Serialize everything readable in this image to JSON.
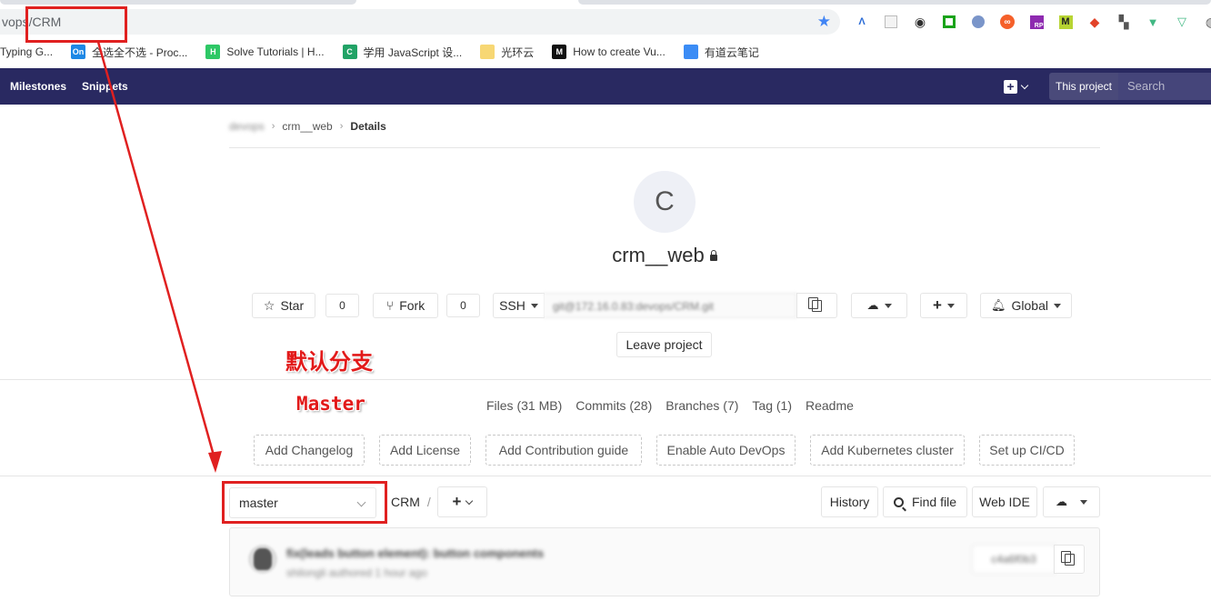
{
  "browser": {
    "url": "vops/CRM",
    "bookmarks": [
      {
        "label": "Typing G...",
        "icon": "bookmark-typing-icon",
        "badge": "",
        "color": "#ffffff"
      },
      {
        "label": "全选全不选 - Proc...",
        "icon": "bookmark-oncoder-icon",
        "badge": "On",
        "color": "#1e88e5"
      },
      {
        "label": "Solve Tutorials | H...",
        "icon": "bookmark-hackerrank-icon",
        "badge": "H",
        "color": "#2ec866"
      },
      {
        "label": "学用 JavaScript 设...",
        "icon": "bookmark-c-icon",
        "badge": "C",
        "color": "#21a366"
      },
      {
        "label": "光环云",
        "icon": "bookmark-folder-icon",
        "badge": "",
        "color": "#f7d774"
      },
      {
        "label": "How to create Vu...",
        "icon": "bookmark-medium-icon",
        "badge": "M",
        "color": "#111111"
      },
      {
        "label": "有道云笔记",
        "icon": "bookmark-youdao-icon",
        "badge": "",
        "color": "#3b8cf5"
      }
    ]
  },
  "nav": {
    "milestones": "Milestones",
    "snippets": "Snippets",
    "scope": "This project",
    "search_placeholder": "Search"
  },
  "breadcrumb": {
    "group": "devops",
    "project": "crm__web",
    "current": "Details"
  },
  "project": {
    "avatar_letter": "C",
    "name": "crm__web",
    "star_label": "Star",
    "star_count": "0",
    "fork_label": "Fork",
    "fork_count": "0",
    "clone_protocol": "SSH",
    "clone_url": "git@172.16.0.83:devops/CRM.git",
    "notification_level": "Global",
    "leave_label": "Leave project"
  },
  "stats": {
    "files": "Files (31 MB)",
    "commits": "Commits (28)",
    "branches": "Branches (7)",
    "tags": "Tag (1)",
    "readme": "Readme"
  },
  "actions": {
    "changelog": "Add Changelog",
    "license": "Add License",
    "contribution": "Add Contribution guide",
    "autodevops": "Enable Auto DevOps",
    "kubernetes": "Add Kubernetes cluster",
    "cicd": "Set up CI/CD"
  },
  "tree": {
    "branch": "master",
    "path": "CRM",
    "slash": "/",
    "history": "History",
    "find_file": "Find file",
    "web_ide": "Web IDE"
  },
  "last_commit": {
    "title": "fix(leads button element): button components",
    "meta": "shilongli authored 1 hour ago",
    "sha": "c4a6f0b3"
  },
  "annotations": {
    "default_branch": "默认分支",
    "master": "Master",
    "color": "#e02020"
  }
}
